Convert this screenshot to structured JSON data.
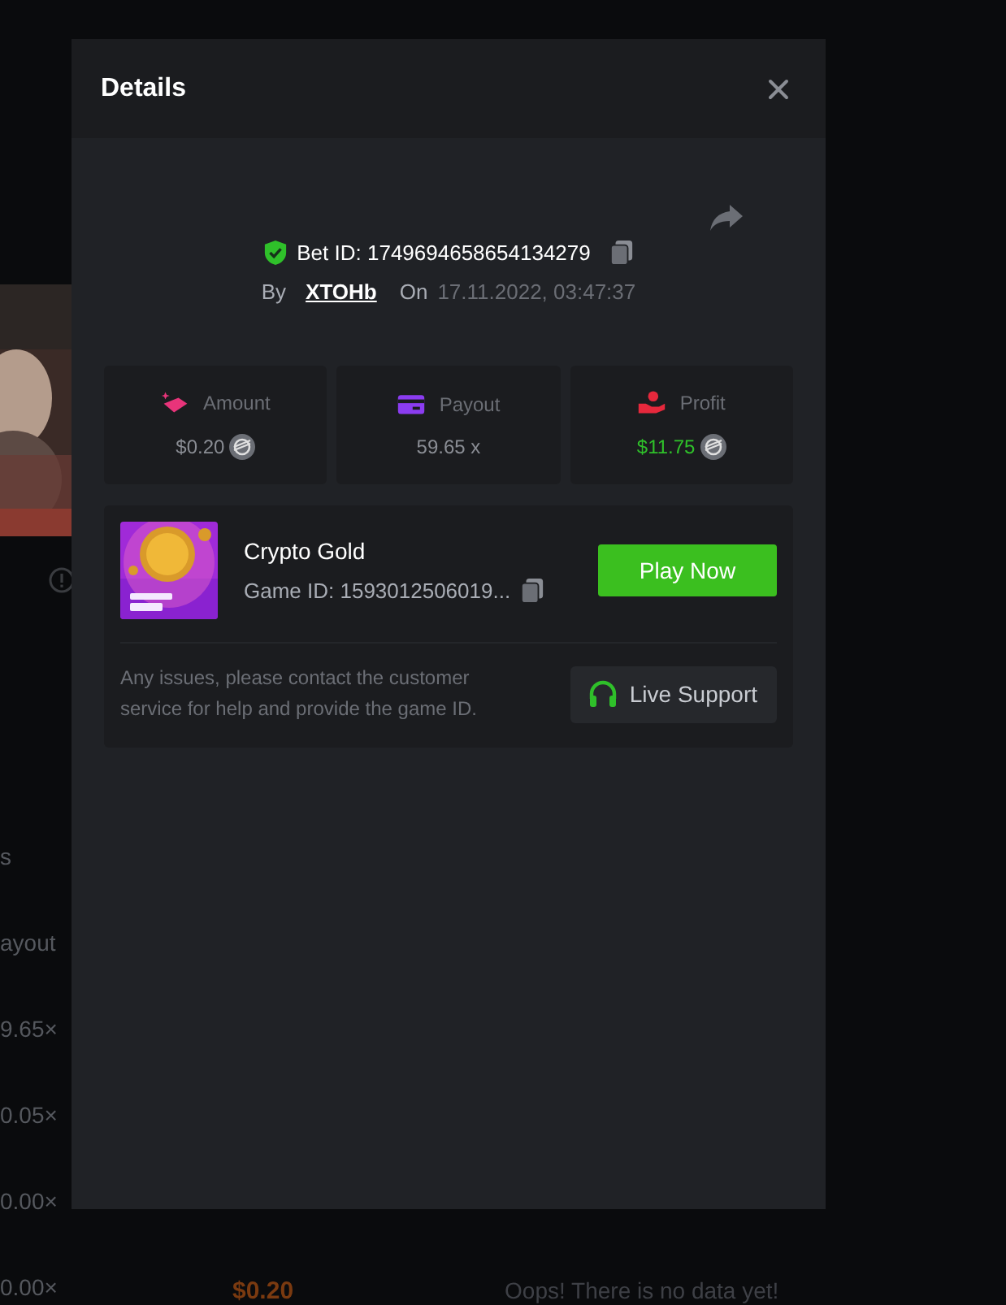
{
  "background": {
    "column_texts": [
      "s",
      "ayout",
      "9.65×",
      "0.05×",
      "0.00×",
      "0.00×"
    ],
    "amount": "$0.20",
    "empty_message": "Oops! There is no data yet!"
  },
  "modal": {
    "title": "Details",
    "bet": {
      "label": "Bet ID: 1749694658654134279",
      "by_label": "By",
      "user": "XTOHb",
      "on_label": "On",
      "date": "17.11.2022, 03:47:37"
    },
    "stats": [
      {
        "kind": "amount",
        "label": "Amount",
        "value": "$0.20",
        "coin": true
      },
      {
        "kind": "payout",
        "label": "Payout",
        "value": "59.65 x",
        "coin": false
      },
      {
        "kind": "profit",
        "label": "Profit",
        "value": "$11.75",
        "coin": true
      }
    ],
    "game": {
      "name": "Crypto Gold",
      "id_text": "Game ID: 1593012506019...",
      "play_button": "Play Now",
      "help_text": "Any issues, please contact the customer service for help and provide the game ID.",
      "support_button": "Live Support"
    }
  }
}
